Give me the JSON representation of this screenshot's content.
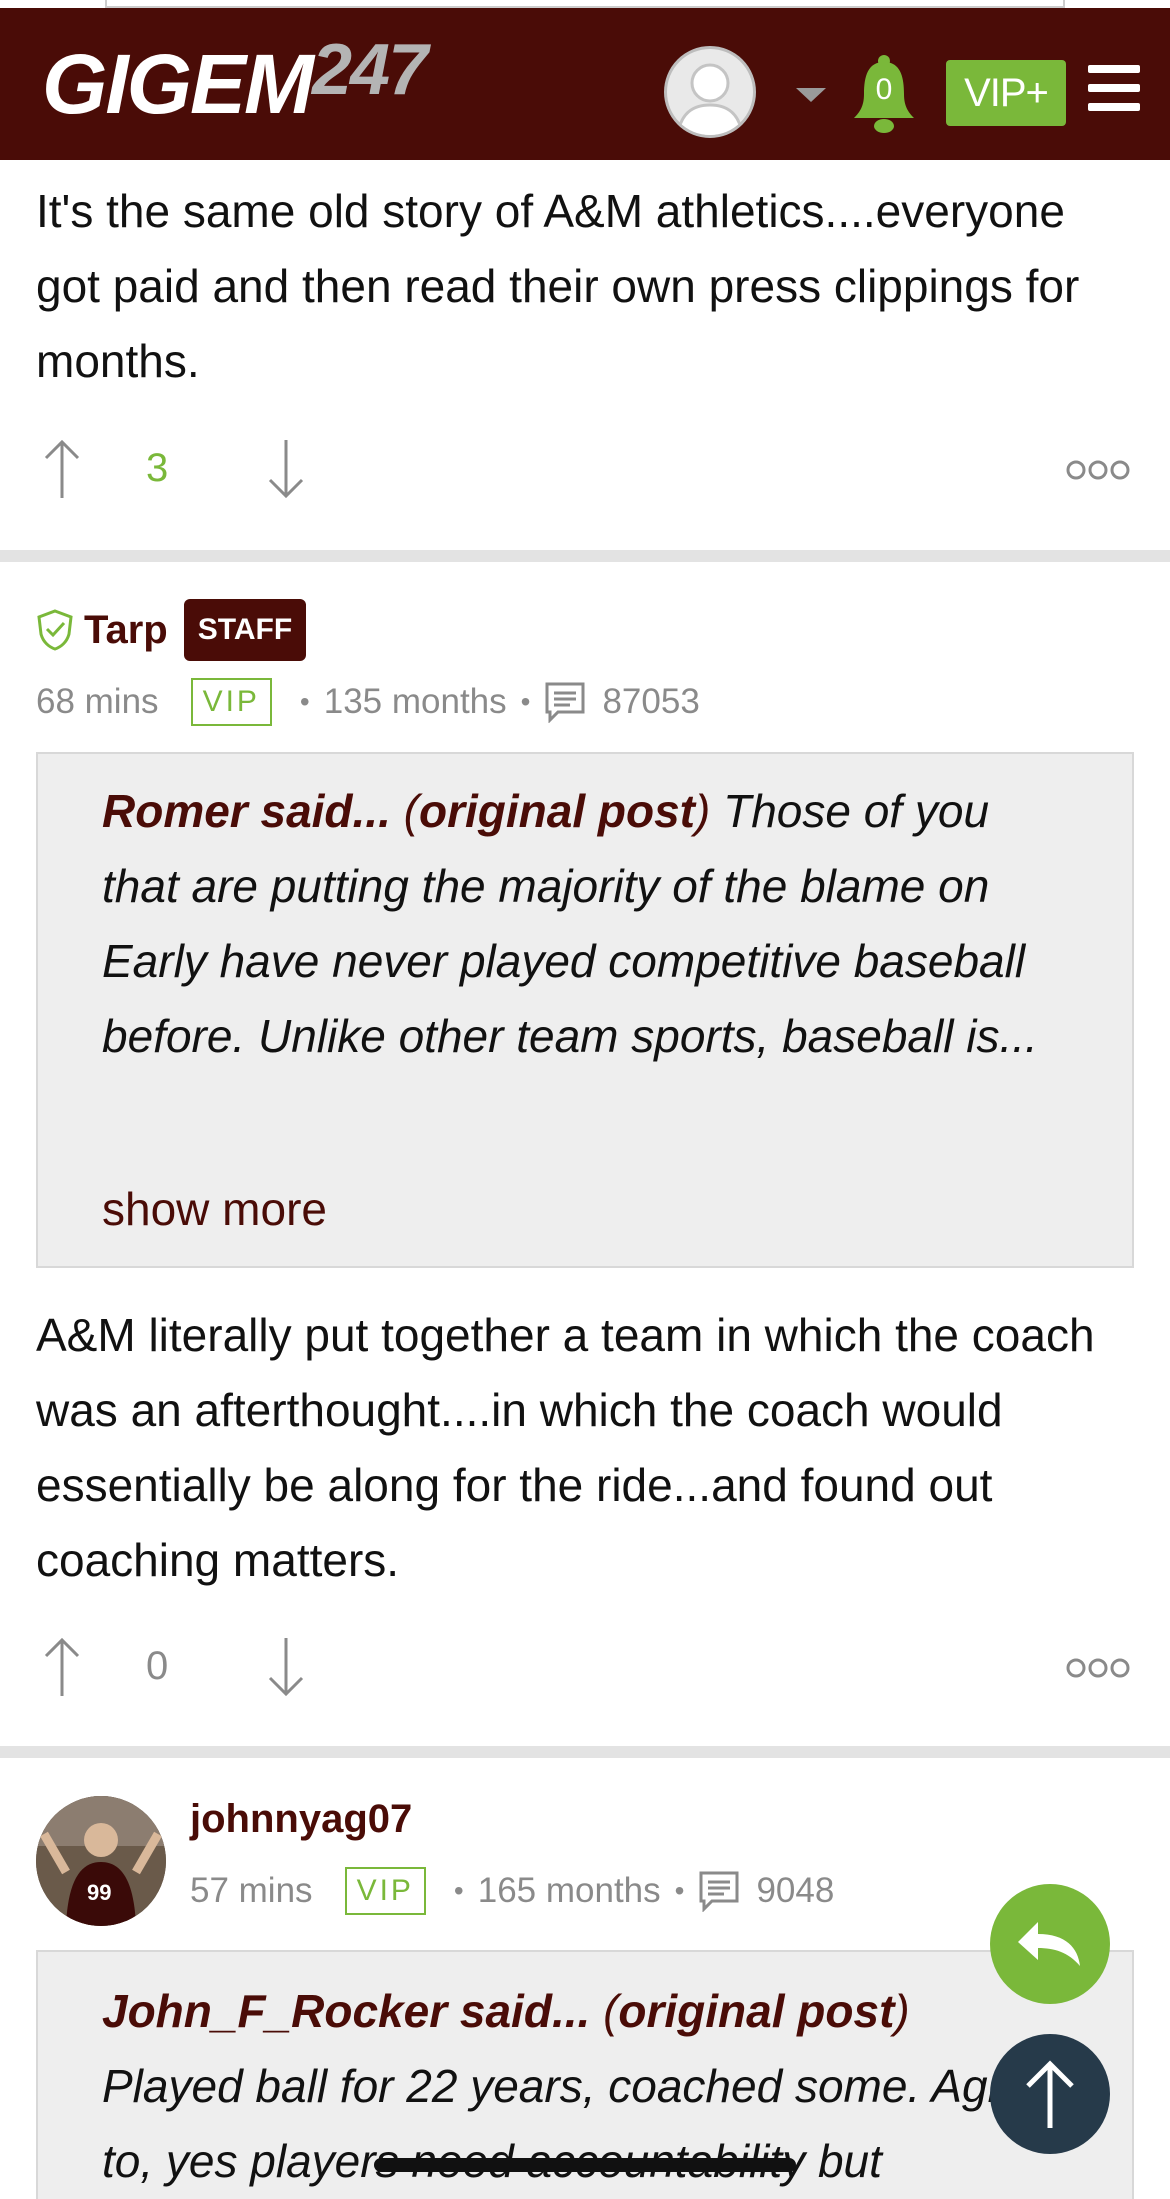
{
  "header": {
    "logo_main": "GIGEM",
    "logo_num": "247",
    "notification_count": "0",
    "vip_label": "VIP+",
    "icons": [
      "user-avatar-icon",
      "caret-down-icon",
      "bell-icon",
      "hamburger-menu-icon"
    ]
  },
  "post1": {
    "body": "It's the same old story of A&M athletics....everyone got paid and then read their own press clippings for months.",
    "upvotes": "3"
  },
  "post2": {
    "author": "Tarp",
    "badge": "STAFF",
    "time": "68 mins",
    "vip_tag": "VIP",
    "tenure": "135 months",
    "post_count": "87053",
    "quote": {
      "quoted_user": "Romer said...",
      "open_paren": "(",
      "original_post": "original post",
      "close_paren": ")",
      "text": "Those of you that are putting the majority of the blame on Early have never played competitive baseball before. Unlike other team sports, baseball is...",
      "show_more": "show more"
    },
    "body": "A&M literally put together a team in which the coach was an afterthought....in which the coach would essentially be along for the ride...and found out coaching matters.",
    "upvotes": "0"
  },
  "post3": {
    "author": "johnnyag07",
    "time": "57 mins",
    "vip_tag": "VIP",
    "tenure": "165 months",
    "post_count": "9048",
    "quote": {
      "quoted_user": "John_F_Rocker said...",
      "open_paren": "(",
      "original_post": "original post",
      "close_paren": ")",
      "text": "Played ball for 22 years, coached some. Agree to, yes players need accountability but"
    }
  },
  "colors": {
    "header_bg": "#4a0c07",
    "accent_green": "#7ab83a",
    "maroon_text": "#4a0c07",
    "meta_gray": "#8a8a8a",
    "quote_bg": "#eeeeee",
    "scroll_top_bg": "#263a4a"
  },
  "fab_icons": [
    "reply-icon",
    "arrow-up-icon"
  ]
}
